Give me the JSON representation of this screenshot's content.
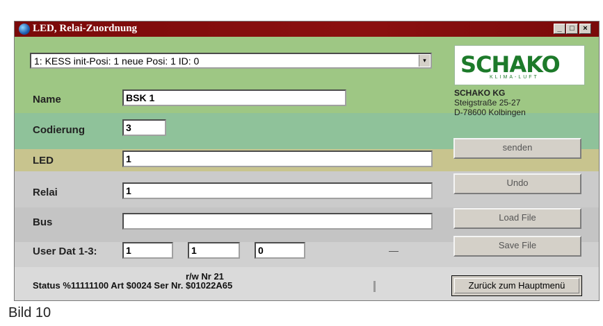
{
  "window": {
    "title": "LED, Relai-Zuordnung",
    "controls": [
      "_",
      "□",
      "×"
    ]
  },
  "selector": {
    "value": "1: KESS init-Posi: 1 neue Posi: 1 ID: 0",
    "arrow": "▾"
  },
  "fields": {
    "name": {
      "label": "Name",
      "value": "BSK 1"
    },
    "codierung": {
      "label": "Codierung",
      "value": "3"
    },
    "led": {
      "label": "LED",
      "value": "1"
    },
    "relai": {
      "label": "Relai",
      "value": "1"
    },
    "bus": {
      "label": "Bus",
      "value": ""
    },
    "user_dat": {
      "label": "User Dat 1-3:",
      "values": [
        "1",
        "1",
        "0"
      ]
    }
  },
  "company": {
    "logo": "SCHAKO",
    "logo_sub": "KLIMA-LUFT",
    "name": "SCHAKO KG",
    "street": "Steigstraße 25-27",
    "city": "D-78600 Kolbingen"
  },
  "buttons": {
    "send": "senden",
    "undo": "Undo",
    "load": "Load File",
    "save": "Save File",
    "back": "Zurück zum Hauptmenü"
  },
  "status": {
    "rw_label": "r/w  Nr   21",
    "line": "Status %11111100  Art $0024  Ser Nr. $01022A65"
  },
  "caption": "Bild 10",
  "colors": {
    "title_bar": "#7a0a0a",
    "green_top": "#9ec784",
    "green_mid": "#8fc29a",
    "yellow_band": "#c8c48e",
    "gray_band": "#c8c8c8"
  }
}
